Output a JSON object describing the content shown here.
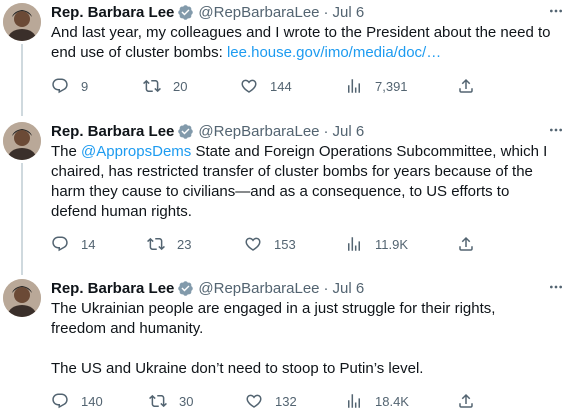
{
  "tweets": [
    {
      "author": {
        "name": "Rep. Barbara Lee",
        "handle": "@RepBarbaraLee",
        "separator": "·",
        "date": "Jul 6"
      },
      "text_lines": [
        {
          "parts": [
            {
              "type": "text",
              "value": "And last year, my colleagues and I wrote to the President about the need to"
            }
          ]
        },
        {
          "parts": [
            {
              "type": "text",
              "value": "end use of cluster bombs: "
            },
            {
              "type": "link",
              "value": "lee.house.gov/imo/media/doc/…"
            }
          ]
        }
      ],
      "stats": {
        "replies": "9",
        "retweets": "20",
        "likes": "144",
        "views": "7,391"
      }
    },
    {
      "author": {
        "name": "Rep. Barbara Lee",
        "handle": "@RepBarbaraLee",
        "separator": "·",
        "date": "Jul 6"
      },
      "text_lines": [
        {
          "parts": [
            {
              "type": "text",
              "value": "The "
            },
            {
              "type": "mention",
              "value": "@AppropsDems"
            },
            {
              "type": "text",
              "value": " State and Foreign Operations Subcommittee, which I"
            }
          ]
        },
        {
          "parts": [
            {
              "type": "text",
              "value": "chaired, has restricted transfer of cluster bombs for years because of the"
            }
          ]
        },
        {
          "parts": [
            {
              "type": "text",
              "value": "harm they cause to civilians—and as a consequence, to US efforts to"
            }
          ]
        },
        {
          "parts": [
            {
              "type": "text",
              "value": "defend human rights."
            }
          ]
        }
      ],
      "stats": {
        "replies": "14",
        "retweets": "23",
        "likes": "153",
        "views": "11.9K"
      }
    },
    {
      "author": {
        "name": "Rep. Barbara Lee",
        "handle": "@RepBarbaraLee",
        "separator": "·",
        "date": "Jul 6"
      },
      "text_lines": [
        {
          "parts": [
            {
              "type": "text",
              "value": "The Ukrainian people are engaged in a just struggle for their rights,"
            }
          ]
        },
        {
          "parts": [
            {
              "type": "text",
              "value": "freedom and humanity."
            }
          ]
        },
        {
          "parts": []
        },
        {
          "parts": [
            {
              "type": "text",
              "value": "The US and Ukraine don’t need to stoop to Putin’s level."
            }
          ]
        }
      ],
      "stats": {
        "replies": "140",
        "retweets": "30",
        "likes": "132",
        "views": "18.4K"
      }
    }
  ],
  "icons": {
    "verified": "verified-badge-icon",
    "more": "more-options-icon",
    "reply": "reply-icon",
    "retweet": "retweet-icon",
    "like": "like-icon",
    "views": "views-icon",
    "share": "share-icon"
  },
  "colors": {
    "accent": "#1d9bf0",
    "text": "#0f1419",
    "muted": "#536471",
    "thread_line": "#cfd9de"
  }
}
